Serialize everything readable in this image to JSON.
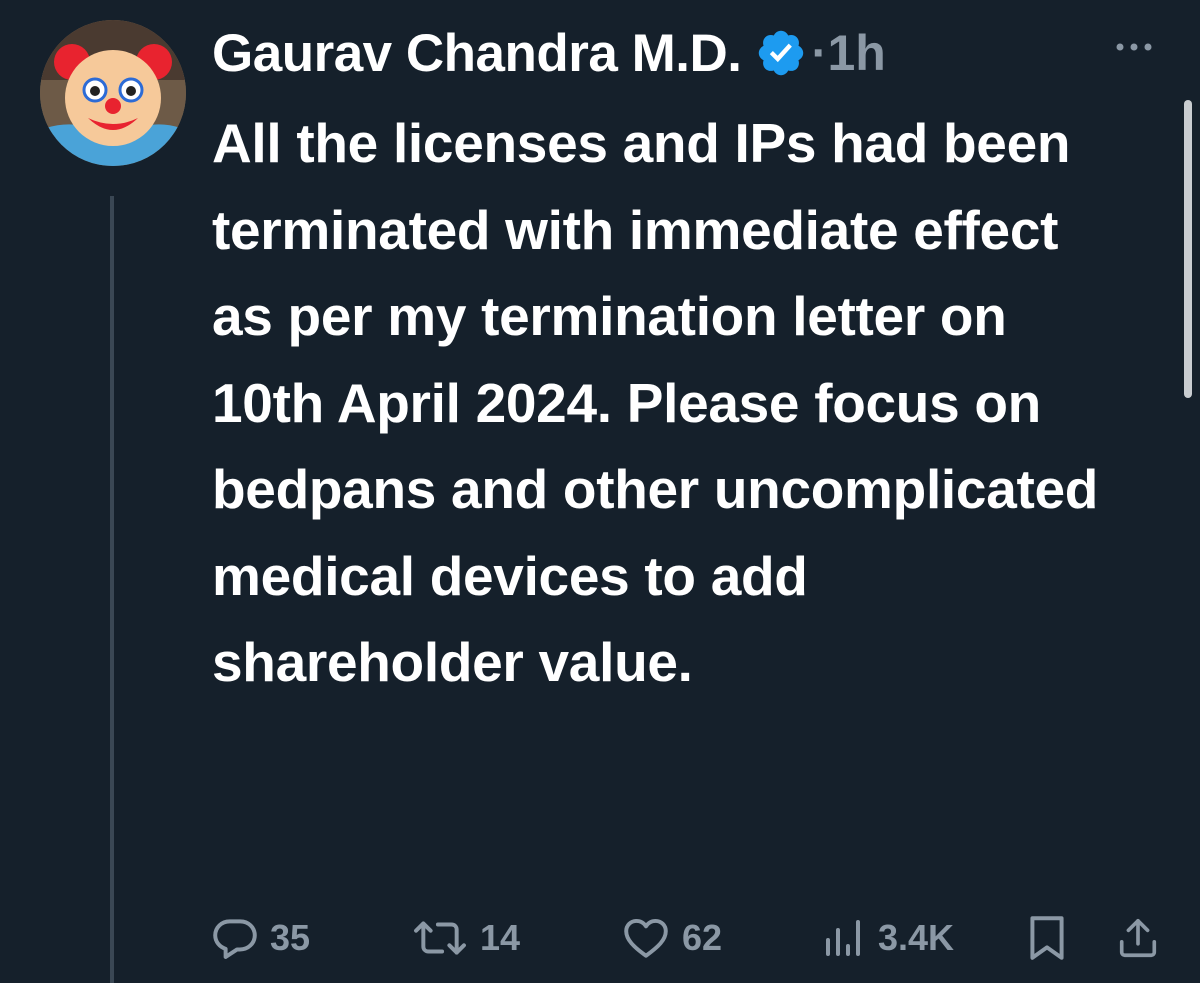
{
  "tweet": {
    "author_name": "Gaurav Chandra M.D.",
    "separator": "·",
    "timestamp": "1h",
    "text": "All the licenses and IPs had been terminated with immediate effect as per my termination letter on 10th April 2024. Please focus on bedpans and other uncomplicated medical devices to add shareholder value.",
    "avatar_icon": "clown-face-icon",
    "verified_icon": "verified-badge-icon",
    "more_icon": "more-options-icon"
  },
  "actions": {
    "replies": "35",
    "retweets": "14",
    "likes": "62",
    "views": "3.4K"
  },
  "colors": {
    "background": "#15202b",
    "text": "#ffffff",
    "secondary": "#8b98a5",
    "verified": "#1d9bf0"
  }
}
